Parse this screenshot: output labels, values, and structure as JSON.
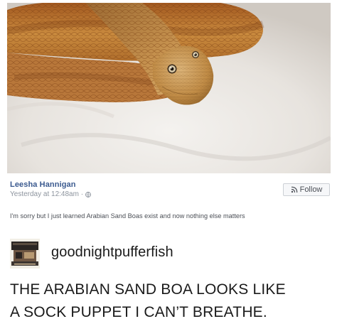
{
  "facebook_post": {
    "photo_icon": "snake-photo",
    "author": "Leesha Hannigan",
    "timestamp": "Yesterday at 12:48am ·",
    "privacy_icon": "globe-icon",
    "follow_icon": "rss-icon",
    "follow_label": "Follow",
    "text": "I'm sorry but I just learned Arabian Sand Boas exist and now nothing else matters"
  },
  "tumblr_post": {
    "avatar_icon": "avatar-image",
    "username": "goodnightpufferfish",
    "body_lines": [
      "THE ARABIAN SAND BOA LOOKS LIKE",
      "A SOCK PUPPET I CAN’T BREATHE."
    ]
  },
  "colors": {
    "author_link": "#3b5a8f",
    "meta_gray": "#8d949e",
    "button_border": "#ccd0d5",
    "body_text": "#1a1a1a"
  }
}
